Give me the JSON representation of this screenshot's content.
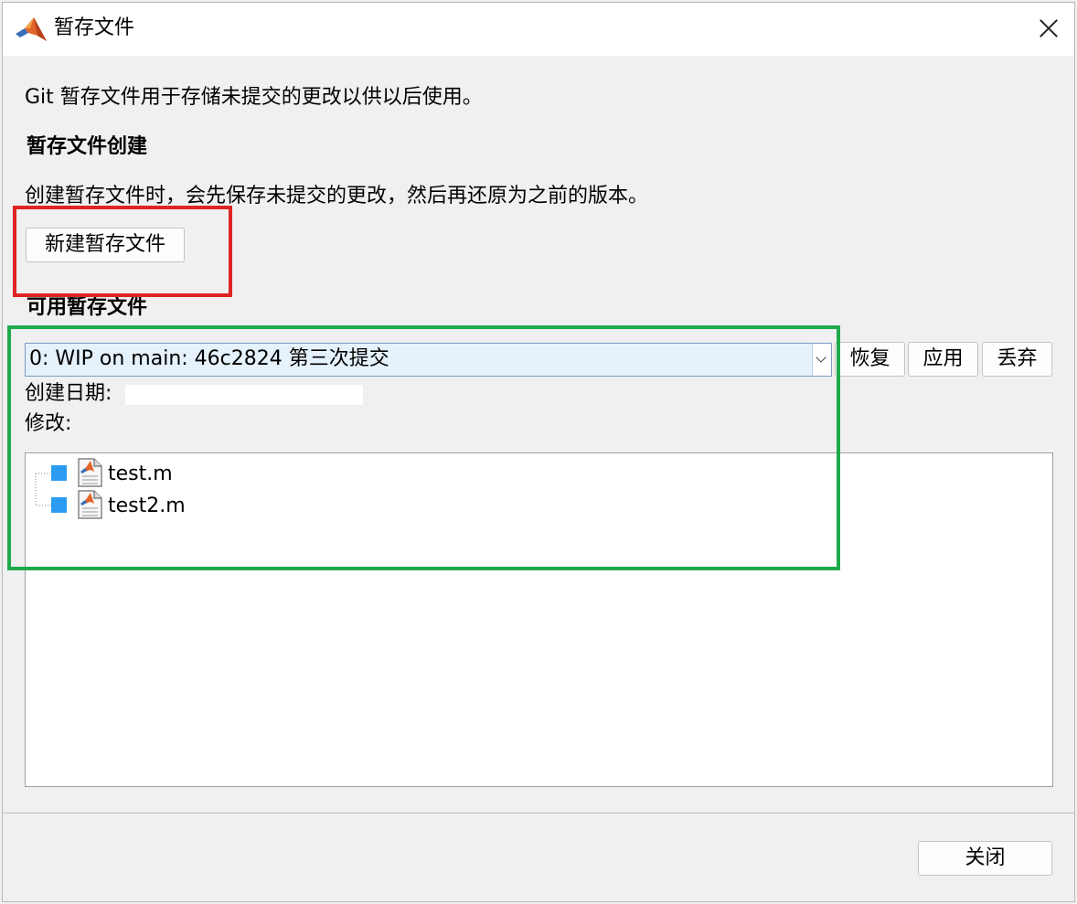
{
  "window": {
    "title": "暂存文件",
    "close_glyph": "×"
  },
  "intro_text": "Git 暂存文件用于存储未提交的更改以供以后使用。",
  "create_section": {
    "heading": "暂存文件创建",
    "description": "创建暂存文件时，会先保存未提交的更改，然后再还原为之前的版本。",
    "new_stash_button": "新建暂存文件"
  },
  "available_section": {
    "heading": "可用暂存文件",
    "selected_stash": "0: WIP on main: 46c2824 第三次提交",
    "buttons": {
      "restore": "恢复",
      "apply": "应用",
      "discard": "丢弃"
    },
    "created_label": "创建日期:",
    "modified_label": "修改:",
    "files": [
      {
        "name": "test.m",
        "icon": "matlab-file-icon"
      },
      {
        "name": "test2.m",
        "icon": "matlab-file-icon"
      }
    ]
  },
  "footer": {
    "close_button": "关闭"
  },
  "colors": {
    "highlight_red": "#e02323",
    "highlight_green": "#1faa4c",
    "combo_selected": "#e5f1fb",
    "tree_node": "#2b9cf2"
  }
}
